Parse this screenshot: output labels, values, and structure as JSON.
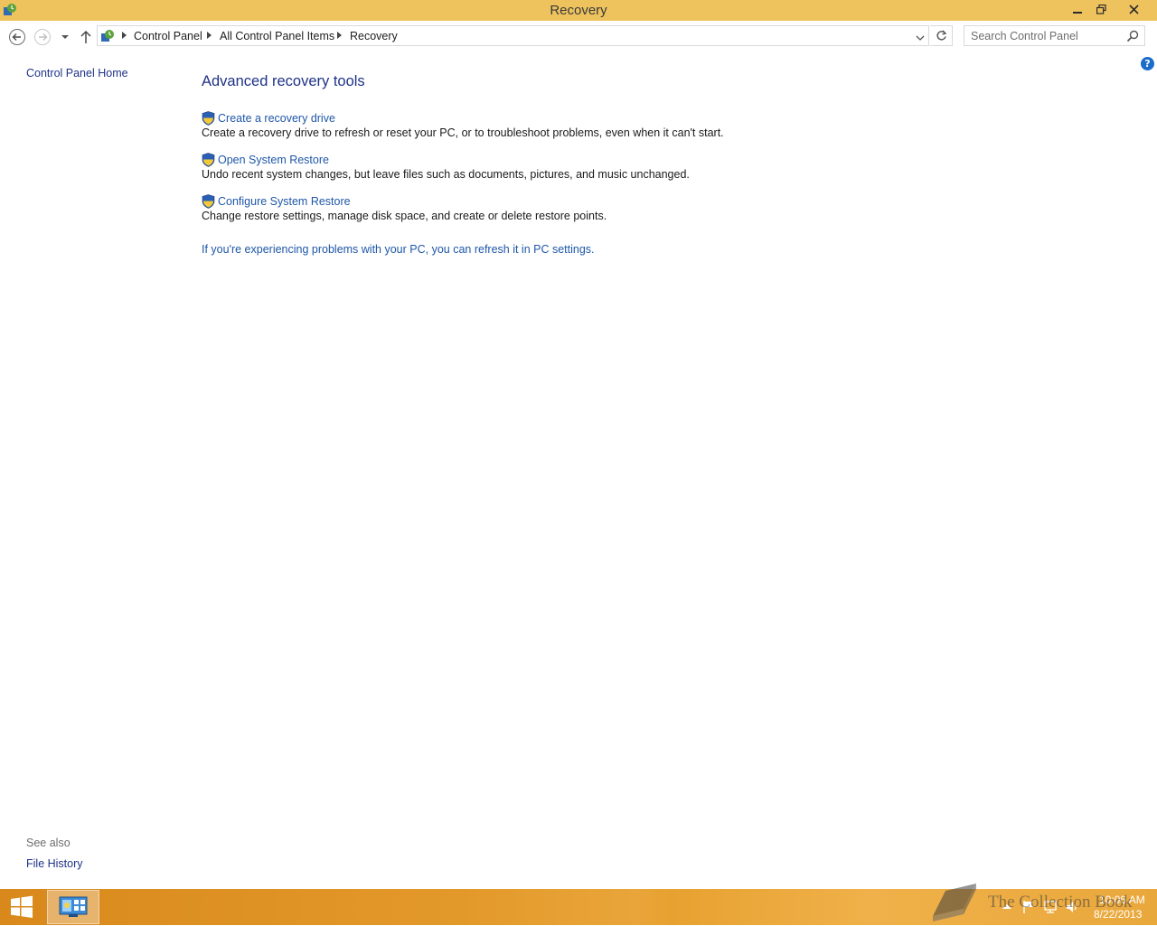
{
  "window": {
    "title": "Recovery",
    "controls": {
      "minimize": "minimize-icon",
      "restore": "restore-icon",
      "close": "close-icon"
    }
  },
  "nav": {
    "breadcrumb": [
      "Control Panel",
      "All Control Panel Items",
      "Recovery"
    ],
    "search_placeholder": "Search Control Panel"
  },
  "left_pane": {
    "home_link": "Control Panel Home",
    "see_also_heading": "See also",
    "see_also_links": [
      "File History"
    ]
  },
  "main": {
    "heading": "Advanced recovery tools",
    "tasks": [
      {
        "label": "Create a recovery drive",
        "description": "Create a recovery drive to refresh or reset your PC, or to troubleshoot problems, even when it can't start."
      },
      {
        "label": "Open System Restore",
        "description": "Undo recent system changes, but leave files such as documents, pictures, and music unchanged."
      },
      {
        "label": "Configure System Restore",
        "description": "Change restore settings, manage disk space, and create or delete restore points."
      }
    ],
    "refresh_link": "If you're experiencing problems with your PC, you can refresh it in PC settings."
  },
  "taskbar": {
    "clock_time": "10:06 AM",
    "clock_date": "8/22/2013",
    "watermark": "The Collection Book"
  },
  "colors": {
    "titlebar": "#eec35e",
    "link": "#1e57a8",
    "heading": "#1e3287",
    "taskbar": "#e3992a"
  }
}
